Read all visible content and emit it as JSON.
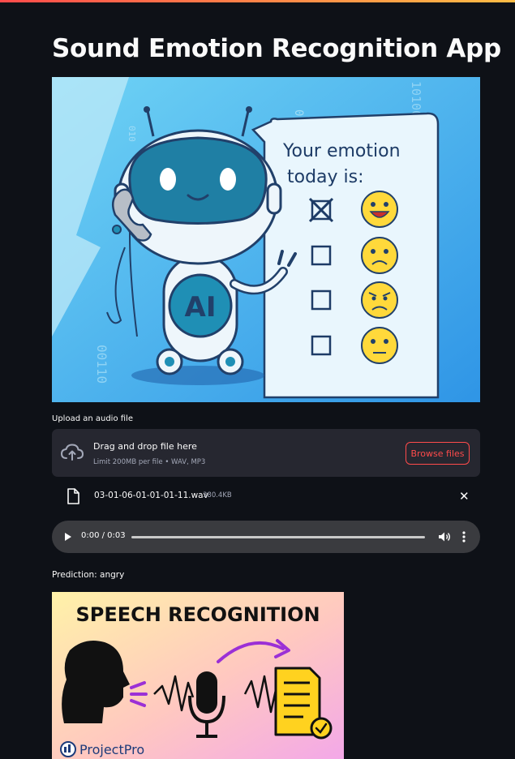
{
  "app": {
    "title": "Sound Emotion Recognition App"
  },
  "hero_image": {
    "heading_line1": "Your emotion",
    "heading_line2": "today is:",
    "badge": "AI",
    "binary_a": "0111",
    "binary_b": "10100111",
    "binary_c": "00110",
    "binary_d": "010",
    "binary_e": "0101"
  },
  "uploader": {
    "label": "Upload an audio file",
    "drop_text": "Drag and drop file here",
    "limit_text": "Limit 200MB per file • WAV, MP3",
    "browse_label": "Browse files"
  },
  "uploaded_file": {
    "name": "03-01-06-01-01-01-11.wav",
    "size": "380.4KB"
  },
  "audio_player": {
    "time": "0:00 / 0:03"
  },
  "result": {
    "prediction": "Prediction: angry"
  },
  "speech_image": {
    "title": "SPEECH RECOGNITION",
    "brand": "ProjectPro"
  },
  "colors": {
    "background": "#0e1117",
    "panel": "#262730",
    "accent": "#ff4b4b",
    "player": "#3a3b3f"
  },
  "icons": [
    "upload-cloud-icon",
    "file-icon",
    "close-icon",
    "play-icon",
    "volume-icon",
    "more-vert-icon"
  ]
}
